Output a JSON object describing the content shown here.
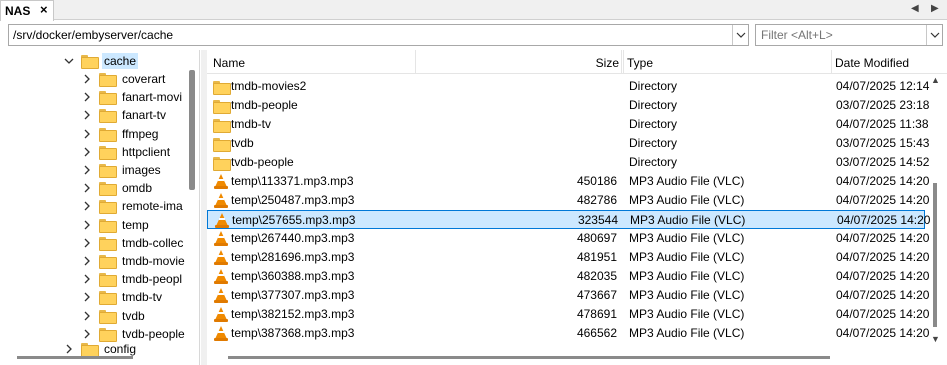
{
  "tab": {
    "label": "NAS",
    "close": "×"
  },
  "nav": {
    "left": "◀",
    "right": "▶"
  },
  "path": {
    "value": "/srv/docker/embyserver/cache",
    "dropdown": "⌄"
  },
  "filter": {
    "placeholder": "Filter <Alt+L>",
    "dropdown": "⌄"
  },
  "tree": {
    "expanded": {
      "label": "cache",
      "chevron": "⌄"
    },
    "children": [
      {
        "label": "coverart",
        "chevron": "›"
      },
      {
        "label": "fanart-movi",
        "chevron": "›"
      },
      {
        "label": "fanart-tv",
        "chevron": "›"
      },
      {
        "label": "ffmpeg",
        "chevron": "›"
      },
      {
        "label": "httpclient",
        "chevron": "›"
      },
      {
        "label": "images",
        "chevron": "›"
      },
      {
        "label": "omdb",
        "chevron": "›"
      },
      {
        "label": "remote-ima",
        "chevron": "›"
      },
      {
        "label": "temp",
        "chevron": "›"
      },
      {
        "label": "tmdb-collec",
        "chevron": "›"
      },
      {
        "label": "tmdb-movie",
        "chevron": "›"
      },
      {
        "label": "tmdb-peopl",
        "chevron": "›"
      },
      {
        "label": "tmdb-tv",
        "chevron": "›"
      },
      {
        "label": "tvdb",
        "chevron": "›"
      },
      {
        "label": "tvdb-people",
        "chevron": "›"
      }
    ],
    "next": {
      "label": "config",
      "chevron": "›"
    }
  },
  "columns": {
    "name": "Name",
    "size": "Size",
    "type": "Type",
    "date": "Date Modified"
  },
  "rows": [
    {
      "icon": "folder-icon",
      "name": "tmdb-movies2",
      "size": "",
      "type": "Directory",
      "date": "04/07/2025 12:14"
    },
    {
      "icon": "folder-icon",
      "name": "tmdb-people",
      "size": "",
      "type": "Directory",
      "date": "03/07/2025 23:18"
    },
    {
      "icon": "folder-icon",
      "name": "tmdb-tv",
      "size": "",
      "type": "Directory",
      "date": "04/07/2025 11:38"
    },
    {
      "icon": "folder-icon",
      "name": "tvdb",
      "size": "",
      "type": "Directory",
      "date": "03/07/2025 15:43"
    },
    {
      "icon": "folder-icon",
      "name": "tvdb-people",
      "size": "",
      "type": "Directory",
      "date": "03/07/2025 14:52"
    },
    {
      "icon": "vlc-icon",
      "name": "temp\\113371.mp3.mp3",
      "size": "450186",
      "type": "MP3 Audio File (VLC)",
      "date": "04/07/2025 14:20"
    },
    {
      "icon": "vlc-icon",
      "name": "temp\\250487.mp3.mp3",
      "size": "482786",
      "type": "MP3 Audio File (VLC)",
      "date": "04/07/2025 14:20"
    },
    {
      "icon": "vlc-icon",
      "name": "temp\\257655.mp3.mp3",
      "size": "323544",
      "type": "MP3 Audio File (VLC)",
      "date": "04/07/2025 14:20",
      "selected": true
    },
    {
      "icon": "vlc-icon",
      "name": "temp\\267440.mp3.mp3",
      "size": "480697",
      "type": "MP3 Audio File (VLC)",
      "date": "04/07/2025 14:20"
    },
    {
      "icon": "vlc-icon",
      "name": "temp\\281696.mp3.mp3",
      "size": "481951",
      "type": "MP3 Audio File (VLC)",
      "date": "04/07/2025 14:20"
    },
    {
      "icon": "vlc-icon",
      "name": "temp\\360388.mp3.mp3",
      "size": "482035",
      "type": "MP3 Audio File (VLC)",
      "date": "04/07/2025 14:20"
    },
    {
      "icon": "vlc-icon",
      "name": "temp\\377307.mp3.mp3",
      "size": "473667",
      "type": "MP3 Audio File (VLC)",
      "date": "04/07/2025 14:20"
    },
    {
      "icon": "vlc-icon",
      "name": "temp\\382152.mp3.mp3",
      "size": "478691",
      "type": "MP3 Audio File (VLC)",
      "date": "04/07/2025 14:20"
    },
    {
      "icon": "vlc-icon",
      "name": "temp\\387368.mp3.mp3",
      "size": "466562",
      "type": "MP3 Audio File (VLC)",
      "date": "04/07/2025 14:20"
    }
  ],
  "scroll": {
    "up": "▲",
    "down": "▼"
  },
  "colors": {
    "selection": "#cce8ff",
    "selection_border": "#0078d7",
    "folder": "#ffd25c",
    "vlc": "#f08a00"
  }
}
